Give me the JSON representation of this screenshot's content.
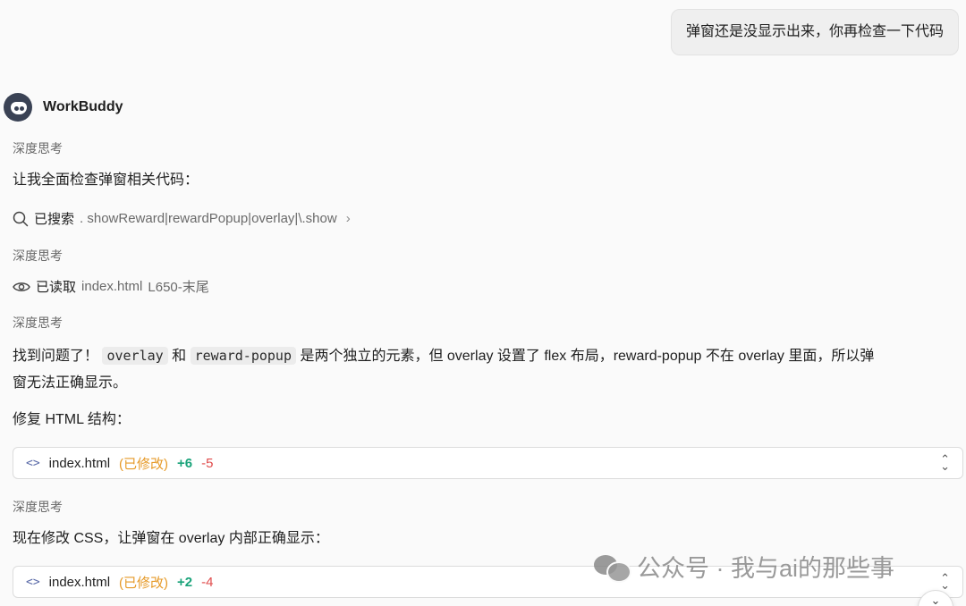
{
  "user_message": "弹窗还是没显示出来，你再检查一下代码",
  "assistant": {
    "name": "WorkBuddy"
  },
  "think_label": "深度思考",
  "messages": {
    "intro": "让我全面检查弹窗相关代码：",
    "search": {
      "label": "已搜索",
      "detail": ". showReward|rewardPopup|overlay|\\.show"
    },
    "read": {
      "label": "已读取",
      "file": "index.html",
      "range": "L650-末尾"
    },
    "finding": {
      "prefix": "找到问题了！",
      "code1": "overlay",
      "mid1": "和",
      "code2": "reward-popup",
      "rest_line1": "是两个独立的元素，但 overlay 设置了 flex 布局，reward-popup 不在 overlay 里面，所以弹",
      "rest_line2": "窗无法正确显示。"
    },
    "fix_html": "修复 HTML 结构：",
    "fix_css": "现在修改 CSS，让弹窗在 overlay 内部正确显示："
  },
  "file_cards": [
    {
      "name": "index.html",
      "status": "(已修改)",
      "added": "+6",
      "removed": "-5"
    },
    {
      "name": "index.html",
      "status": "(已修改)",
      "added": "+2",
      "removed": "-4"
    }
  ],
  "watermark": "公众号 · 我与ai的那些事",
  "icons": {
    "search": "search-icon",
    "eye": "eye-icon",
    "code": "code-icon",
    "expand": "expand-collapse-icon",
    "chevron": "chevron-right-icon",
    "scroll_down": "chevron-down-icon"
  },
  "colors": {
    "modified": "#e69a28",
    "added": "#1aa37a",
    "removed": "#e04b4b"
  }
}
